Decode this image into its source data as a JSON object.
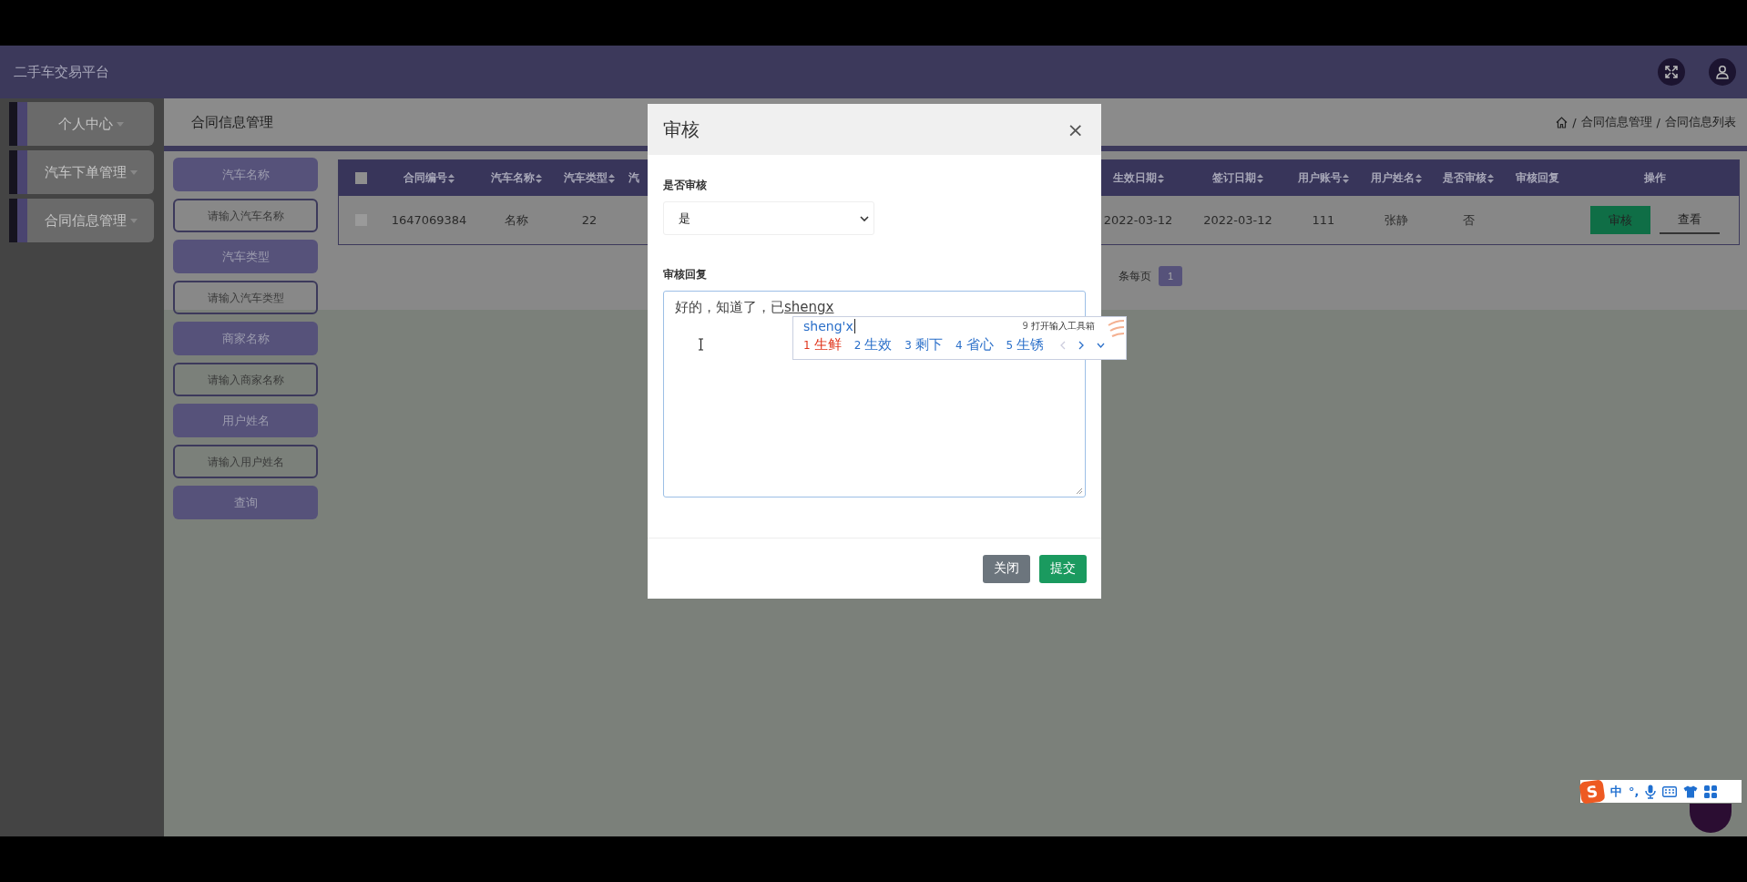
{
  "app": {
    "title": "二手车交易平台"
  },
  "header_actions": [
    {
      "kind": "fullscreen"
    },
    {
      "kind": "user"
    }
  ],
  "sidebar": {
    "items": [
      {
        "label": "个人中心"
      },
      {
        "label": "汽车下单管理"
      },
      {
        "label": "合同信息管理"
      }
    ]
  },
  "page": {
    "title": "合同信息管理",
    "separator": "/",
    "breadcrumb": [
      "合同信息管理",
      "合同信息列表"
    ]
  },
  "search": {
    "fields": [
      {
        "label": "汽车名称",
        "placeholder": "请输入汽车名称"
      },
      {
        "label": "汽车类型",
        "placeholder": "请输入汽车类型"
      },
      {
        "label": "商家名称",
        "placeholder": "请输入商家名称"
      },
      {
        "label": "用户姓名",
        "placeholder": "请输入用户姓名"
      }
    ],
    "button": "查询"
  },
  "table": {
    "all_checked": false,
    "columns": [
      {
        "label": "合同编号",
        "sortable": true
      },
      {
        "label": "汽车名称",
        "sortable": true
      },
      {
        "label": "汽车类型",
        "sortable": true
      },
      {
        "label": "汽",
        "sortable": false
      },
      {
        "label": "生效日期",
        "sortable": true
      },
      {
        "label": "签订日期",
        "sortable": true
      },
      {
        "label": "用户账号",
        "sortable": true
      },
      {
        "label": "用户姓名",
        "sortable": true
      },
      {
        "label": "是否审核",
        "sortable": true
      },
      {
        "label": "审核回复",
        "sortable": false
      },
      {
        "label": "操作",
        "sortable": false
      }
    ],
    "rows": [
      {
        "checked": false,
        "cells": [
          "1647069384",
          "名称",
          "22",
          null,
          "2022-03-12",
          "2022-03-12",
          "111",
          "张静",
          "否",
          null
        ],
        "actions": [
          {
            "label": "审核",
            "kind": "primary"
          },
          {
            "label": "查看",
            "kind": "link"
          }
        ]
      }
    ]
  },
  "pagination": {
    "per_page_label": "条每页",
    "pages": [
      {
        "label": "1",
        "selected": true
      }
    ]
  },
  "dialog": {
    "title": "审核",
    "close": "×",
    "audit": {
      "label": "是否审核",
      "value": "是"
    },
    "reply": {
      "label": "审核回复",
      "committed": "好的，知道了，已",
      "composing": "shengx"
    },
    "buttons": [
      {
        "label": "关闭",
        "kind": "secondary"
      },
      {
        "label": "提交",
        "kind": "primary"
      }
    ]
  },
  "ime_candidates": {
    "pinyin": "sheng'x",
    "tool_number": "9",
    "tool_hint": "打开输入工具箱",
    "candidates": [
      {
        "number": "1",
        "text": "生鲜",
        "selected": true
      },
      {
        "number": "2",
        "text": "生效",
        "selected": false
      },
      {
        "number": "3",
        "text": "剩下",
        "selected": false
      },
      {
        "number": "4",
        "text": "省心",
        "selected": false
      },
      {
        "number": "5",
        "text": "生锈",
        "selected": false
      }
    ]
  },
  "ime_toolbar": {
    "logo": "S",
    "mode": "中",
    "punctuation": "°,"
  }
}
